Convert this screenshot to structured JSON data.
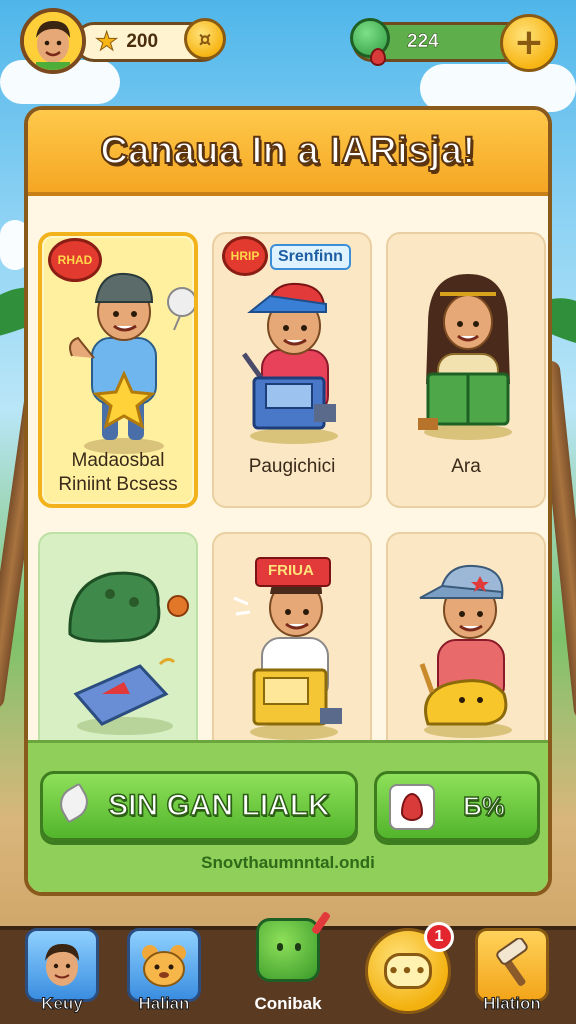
{
  "header": {
    "coins": "200",
    "gems": "224"
  },
  "panel": {
    "title": "Canaua In a IARisja!"
  },
  "cards": [
    {
      "label_line1": "Madaosbal",
      "label_line2": "Riniint Bcsess",
      "selected": true
    },
    {
      "label_line1": "Paugichici",
      "tag": "Srenfinn",
      "speech": "HRIP"
    },
    {
      "label_line1": "Ara"
    },
    {
      "label_line1": ""
    },
    {
      "label_line1": "",
      "cap_text": "FRIUA"
    },
    {
      "label_line1": ""
    }
  ],
  "cards_top": {
    "speech_text": "RHAD"
  },
  "actions": {
    "primary_label": "SIN GAN LIALK",
    "secondary_label": "Б%",
    "footer_link": "Snovthaumnntal.ondi"
  },
  "nav": {
    "items": [
      {
        "label": "Keuy"
      },
      {
        "label": "Halian"
      },
      {
        "label": "Conibak"
      },
      {
        "label": "",
        "badge": "1"
      },
      {
        "label": "Hlation"
      }
    ]
  },
  "colors": {
    "accent": "#f5a623",
    "primary_button": "#52b52b",
    "panel_bg": "#fff7e3",
    "nav_bg": "#5a3b22"
  }
}
